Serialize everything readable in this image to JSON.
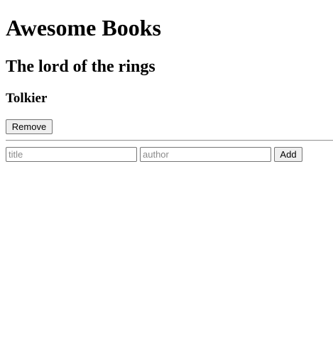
{
  "header": {
    "title": "Awesome Books"
  },
  "books": [
    {
      "title": "The lord of the rings",
      "author": "Tolkier",
      "remove_label": "Remove"
    }
  ],
  "form": {
    "title_value": "",
    "title_placeholder": "title",
    "author_value": "",
    "author_placeholder": "author",
    "add_label": "Add"
  }
}
